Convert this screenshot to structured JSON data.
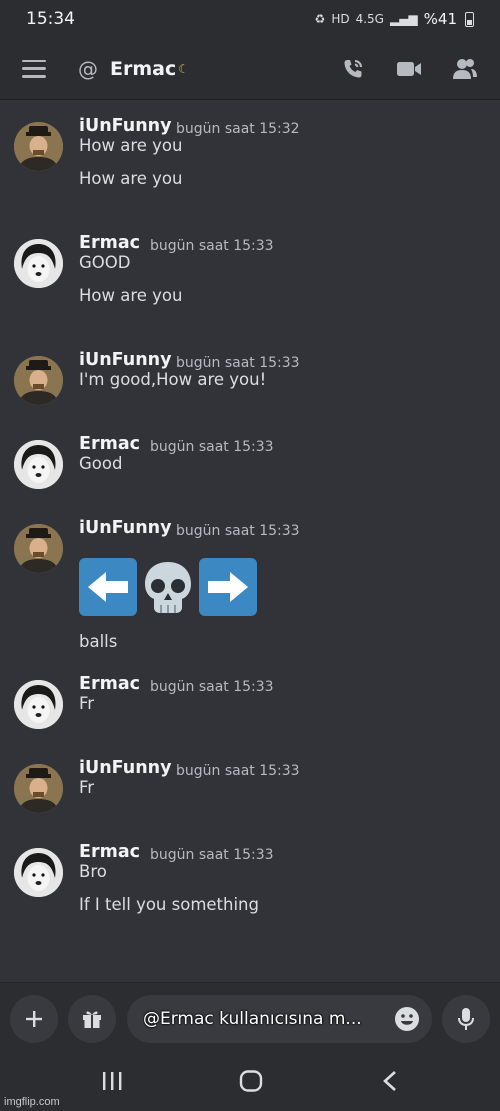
{
  "status_bar": {
    "time": "15:34",
    "network": "4.5G",
    "battery": "%41"
  },
  "header": {
    "channel_name": "Ermac",
    "status_icon": "moon-icon",
    "actions": [
      "voice-call-icon",
      "video-call-icon",
      "members-icon"
    ]
  },
  "messages": [
    {
      "author": "iUnFunny",
      "timestamp": "bugün saat 15:32",
      "lines": [
        "How are you",
        "How are you"
      ]
    },
    {
      "author": "Ermac",
      "timestamp": "bugün saat 15:33",
      "lines": [
        "GOOD",
        "How are you"
      ]
    },
    {
      "author": "iUnFunny",
      "timestamp": "bugün saat 15:33",
      "lines": [
        "I'm good,How are you!"
      ]
    },
    {
      "author": "Ermac",
      "timestamp": "bugün saat 15:33",
      "lines": [
        "Good"
      ]
    },
    {
      "author": "iUnFunny",
      "timestamp": "bugün saat 15:33",
      "emojis": [
        "left-arrow-emoji",
        "skull-emoji",
        "right-arrow-emoji"
      ],
      "lines": [
        "balls"
      ]
    },
    {
      "author": "Ermac",
      "timestamp": "bugün saat 15:33",
      "lines": [
        "Fr"
      ]
    },
    {
      "author": "iUnFunny",
      "timestamp": "bugün saat 15:33",
      "lines": [
        "Fr"
      ]
    },
    {
      "author": "Ermac",
      "timestamp": "bugün saat 15:33",
      "lines": [
        "Bro",
        "If I tell you something"
      ]
    }
  ],
  "composer": {
    "placeholder": "@Ermac kullanıcısına m..."
  },
  "watermark": "imgflip.com",
  "colors": {
    "background": "#313338",
    "header": "#2b2d31",
    "timestamp": "#b5bac1",
    "arrow_emoji": "#3b88c3"
  }
}
